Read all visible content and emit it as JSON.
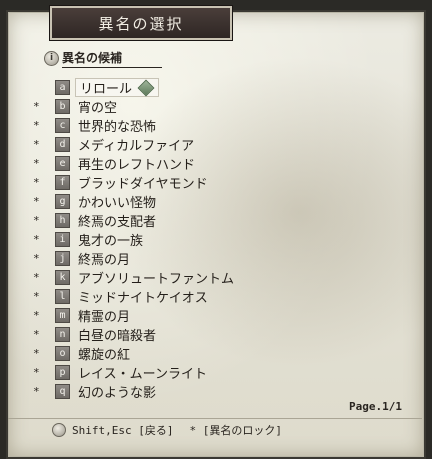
{
  "window": {
    "title": "異名の選択"
  },
  "section": {
    "label": "異名の候補",
    "icon": "info-icon"
  },
  "items": [
    {
      "key": "a",
      "name": "リロール",
      "locked": false,
      "selected": true
    },
    {
      "key": "b",
      "name": "宵の空",
      "locked": true
    },
    {
      "key": "c",
      "name": "世界的な恐怖",
      "locked": true
    },
    {
      "key": "d",
      "name": "メディカルファイア",
      "locked": true
    },
    {
      "key": "e",
      "name": "再生のレフトハンド",
      "locked": true
    },
    {
      "key": "f",
      "name": "ブラッドダイヤモンド",
      "locked": true
    },
    {
      "key": "g",
      "name": "かわいい怪物",
      "locked": true
    },
    {
      "key": "h",
      "name": "終焉の支配者",
      "locked": true
    },
    {
      "key": "i",
      "name": "鬼才の一族",
      "locked": true
    },
    {
      "key": "j",
      "name": "終焉の月",
      "locked": true
    },
    {
      "key": "k",
      "name": "アブソリュートファントム",
      "locked": true
    },
    {
      "key": "l",
      "name": "ミッドナイトケイオス",
      "locked": true
    },
    {
      "key": "m",
      "name": "精霊の月",
      "locked": true
    },
    {
      "key": "n",
      "name": "白昼の暗殺者",
      "locked": true
    },
    {
      "key": "o",
      "name": "螺旋の紅",
      "locked": true
    },
    {
      "key": "p",
      "name": "レイス・ムーンライト",
      "locked": true
    },
    {
      "key": "q",
      "name": "幻のような影",
      "locked": true
    }
  ],
  "lock_mark": "*",
  "page": "Page.1/1",
  "footer": {
    "hint_back": "Shift,Esc [戻る]",
    "hint_lock": "* [異名のロック]"
  }
}
